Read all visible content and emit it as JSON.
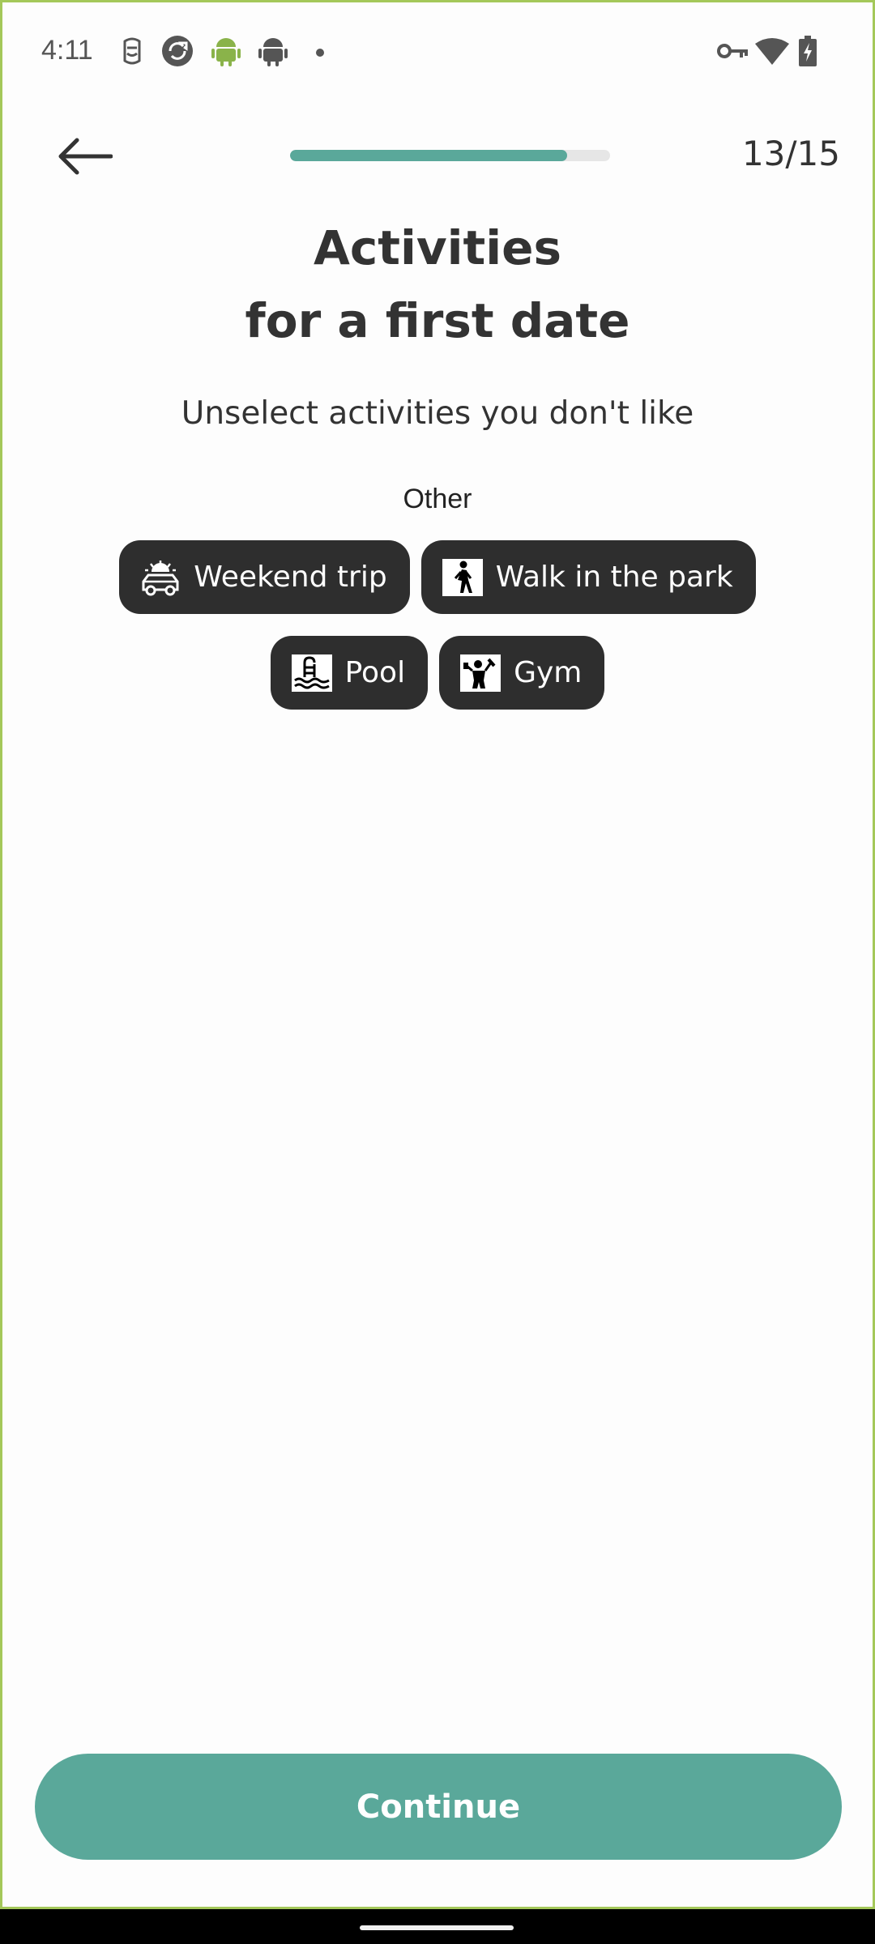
{
  "status_bar": {
    "time": "4:11",
    "left_icons": [
      "face-unlock-icon",
      "sync-app-icon",
      "android-green-icon",
      "android-gray-icon",
      "notification-dot-icon"
    ],
    "right_icons": [
      "vpn-key-icon",
      "wifi-icon",
      "battery-charging-icon"
    ]
  },
  "header": {
    "back_icon": "arrow-left-icon",
    "progress_fraction": 0.867,
    "progress_color": "#5aa89a",
    "step_counter": "13/15"
  },
  "content": {
    "title_line1": "Activities",
    "title_line2": "for a first date",
    "subtitle": "Unselect activities you don't like",
    "section_label": "Other",
    "chips": [
      {
        "label": "Weekend trip",
        "icon": "car-sun-icon"
      },
      {
        "label": "Walk in the park",
        "icon": "walking-person-icon"
      },
      {
        "label": "Pool",
        "icon": "pool-ladder-icon"
      },
      {
        "label": "Gym",
        "icon": "weightlifter-icon"
      }
    ]
  },
  "footer": {
    "continue_label": "Continue",
    "accent_color": "#5aa89a"
  }
}
